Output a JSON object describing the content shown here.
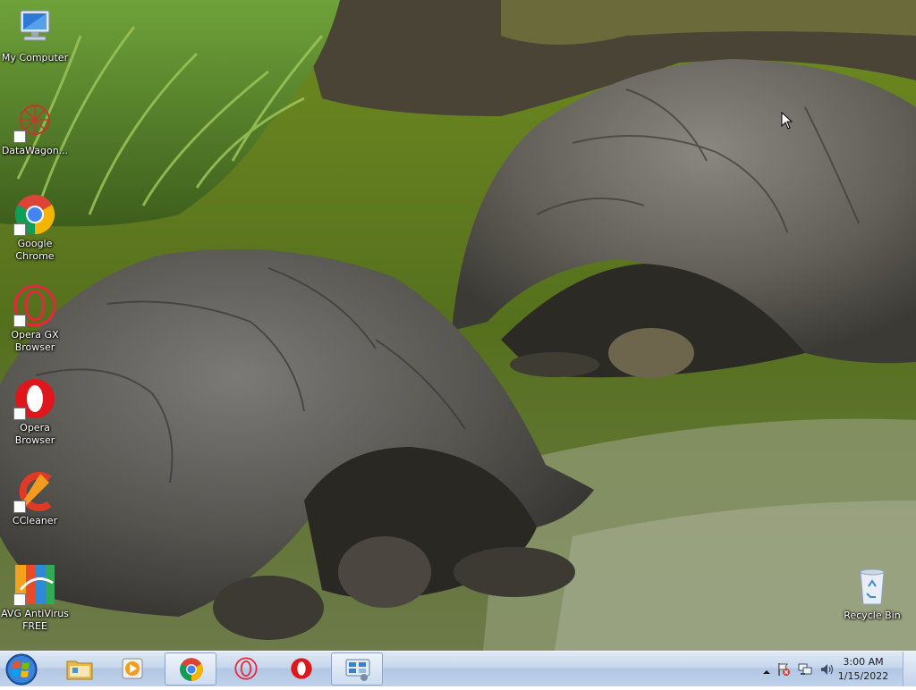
{
  "desktop": {
    "icons": [
      {
        "label": "My Computer",
        "icon": "computer-icon"
      },
      {
        "label": "DataWagon...",
        "icon": "datawagon-icon"
      },
      {
        "label": "Google Chrome",
        "icon": "chrome-icon"
      },
      {
        "label": "Opera GX Browser",
        "icon": "opera-gx-icon"
      },
      {
        "label": "Opera Browser",
        "icon": "opera-icon"
      },
      {
        "label": "CCleaner",
        "icon": "ccleaner-icon"
      },
      {
        "label": "AVG AntiVirus FREE",
        "icon": "avg-icon"
      },
      {
        "label": "Recycle Bin",
        "icon": "recycle-bin-icon"
      }
    ],
    "wallpaper": "two giant tortoises in green water"
  },
  "taskbar": {
    "start": {
      "icon": "windows-start-icon"
    },
    "pinned": [
      {
        "icon": "file-explorer-icon",
        "active": false
      },
      {
        "icon": "media-player-icon",
        "active": false
      },
      {
        "icon": "chrome-icon",
        "active": true
      },
      {
        "icon": "opera-gx-icon",
        "active": false
      },
      {
        "icon": "opera-icon",
        "active": false
      },
      {
        "icon": "network-app-icon",
        "active": true
      }
    ],
    "tray": {
      "icons": [
        "show-hidden-icons-chevron",
        "action-center-flag-icon",
        "network-icon",
        "volume-icon"
      ],
      "time": "3:00 AM",
      "date": "1/15/2022"
    }
  },
  "colors": {
    "taskbar_top": "#dfe9f6",
    "taskbar_bottom": "#c0d3ec",
    "label_text": "#ffffff",
    "chrome_red": "#db4437",
    "chrome_green": "#0f9d58",
    "chrome_yellow": "#f4b400",
    "chrome_blue": "#4285f4",
    "opera_red": "#e0161d",
    "opera_gx_red": "#e8263a"
  }
}
